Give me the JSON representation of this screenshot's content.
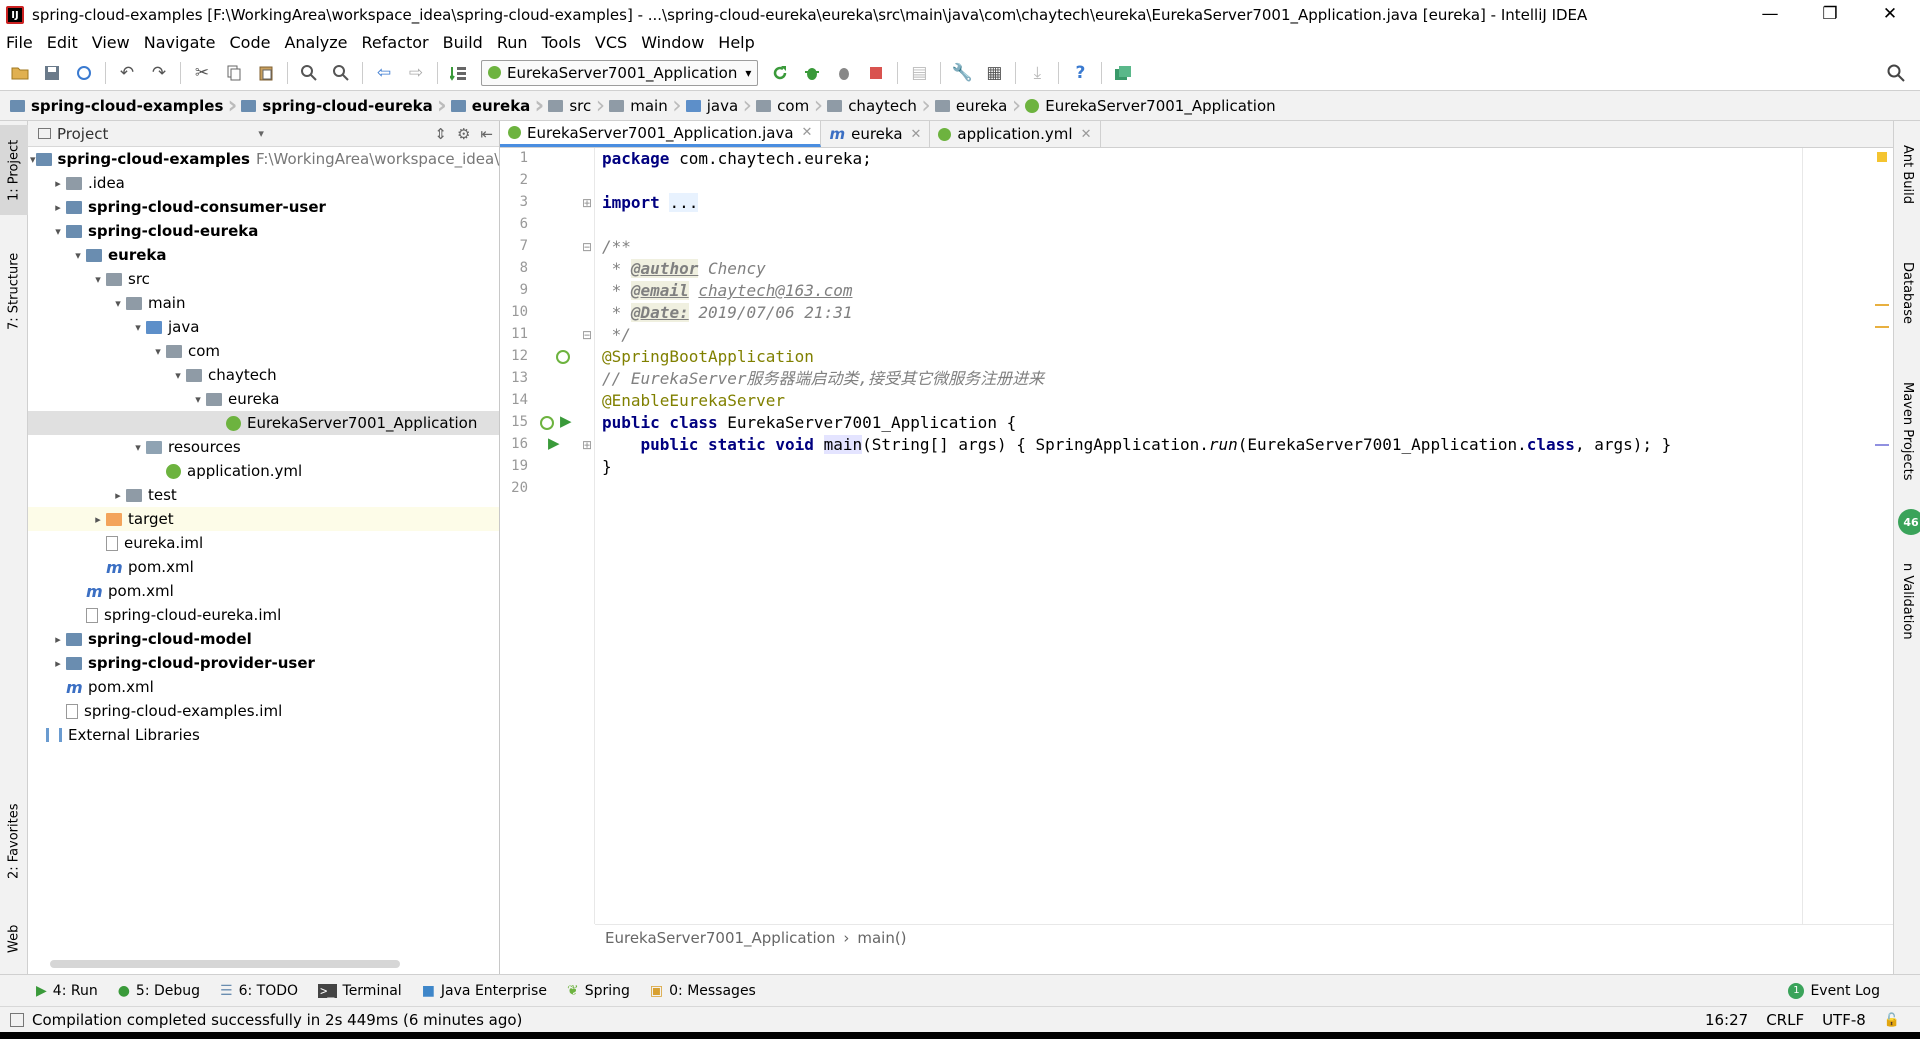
{
  "window": {
    "title": "spring-cloud-examples [F:\\WorkingArea\\workspace_idea\\spring-cloud-examples] - ...\\spring-cloud-eureka\\eureka\\src\\main\\java\\com\\chaytech\\eureka\\EurekaServer7001_Application.java [eureka] - IntelliJ IDEA",
    "minimize": "—",
    "restore": "❐",
    "close": "✕"
  },
  "menu": [
    "File",
    "Edit",
    "View",
    "Navigate",
    "Code",
    "Analyze",
    "Refactor",
    "Build",
    "Run",
    "Tools",
    "VCS",
    "Window",
    "Help"
  ],
  "toolbar": {
    "run_config": "EurekaServer7001_Application",
    "run_config_caret": "▾"
  },
  "breadcrumb": [
    "spring-cloud-examples",
    "spring-cloud-eureka",
    "eureka",
    "src",
    "main",
    "java",
    "com",
    "chaytech",
    "eureka",
    "EurekaServer7001_Application"
  ],
  "left_tools": {
    "project": "1: Project",
    "structure": "7: Structure",
    "favorites": "2: Favorites",
    "web": "Web"
  },
  "right_tools": {
    "ant": "Ant Build",
    "database": "Database",
    "maven": "Maven Projects",
    "validation": "n Validation",
    "validation_badge": "46"
  },
  "project_panel": {
    "header": "Project",
    "tree": [
      {
        "label": "spring-cloud-examples",
        "path": "F:\\WorkingArea\\workspace_idea\\spri",
        "level": 0,
        "arrow": "▾",
        "icon": "foldmod",
        "bold": true
      },
      {
        "label": ".idea",
        "level": 1,
        "arrow": "▸",
        "icon": "fold"
      },
      {
        "label": "spring-cloud-consumer-user",
        "level": 1,
        "arrow": "▸",
        "icon": "foldmod",
        "bold": true
      },
      {
        "label": "spring-cloud-eureka",
        "level": 1,
        "arrow": "▾",
        "icon": "foldmod",
        "bold": true
      },
      {
        "label": "eureka",
        "level": 2,
        "arrow": "▾",
        "icon": "foldmod",
        "bold": true
      },
      {
        "label": "src",
        "level": 3,
        "arrow": "▾",
        "icon": "fold"
      },
      {
        "label": "main",
        "level": 4,
        "arrow": "▾",
        "icon": "fold"
      },
      {
        "label": "java",
        "level": 5,
        "arrow": "▾",
        "icon": "foldsrc"
      },
      {
        "label": "com",
        "level": 6,
        "arrow": "▾",
        "icon": "fold"
      },
      {
        "label": "chaytech",
        "level": 7,
        "arrow": "▾",
        "icon": "fold"
      },
      {
        "label": "eureka",
        "level": 8,
        "arrow": "▾",
        "icon": "fold"
      },
      {
        "label": "EurekaServer7001_Application",
        "level": 9,
        "arrow": "",
        "icon": "spring",
        "selected": true
      },
      {
        "label": "resources",
        "level": 5,
        "arrow": "▾",
        "icon": "foldres"
      },
      {
        "label": "application.yml",
        "level": 6,
        "arrow": "",
        "icon": "spring"
      },
      {
        "label": "test",
        "level": 4,
        "arrow": "▸",
        "icon": "fold"
      },
      {
        "label": "target",
        "level": 3,
        "arrow": "▸",
        "icon": "foldtarget",
        "highlight": true
      },
      {
        "label": "eureka.iml",
        "level": 3,
        "arrow": "",
        "icon": "file"
      },
      {
        "label": "pom.xml",
        "level": 3,
        "arrow": "",
        "icon": "mvn"
      },
      {
        "label": "pom.xml",
        "level": 2,
        "arrow": "",
        "icon": "mvn"
      },
      {
        "label": "spring-cloud-eureka.iml",
        "level": 2,
        "arrow": "",
        "icon": "file"
      },
      {
        "label": "spring-cloud-model",
        "level": 1,
        "arrow": "▸",
        "icon": "foldmod",
        "bold": true
      },
      {
        "label": "spring-cloud-provider-user",
        "level": 1,
        "arrow": "▸",
        "icon": "foldmod",
        "bold": true
      },
      {
        "label": "pom.xml",
        "level": 1,
        "arrow": "",
        "icon": "mvn"
      },
      {
        "label": "spring-cloud-examples.iml",
        "level": 1,
        "arrow": "",
        "icon": "file"
      },
      {
        "label": "External Libraries",
        "level": 0,
        "arrow": "",
        "icon": "libs"
      }
    ]
  },
  "editor": {
    "tabs": [
      {
        "label": "EurekaServer7001_Application.java",
        "active": true,
        "color": "#6db33f"
      },
      {
        "label": "eureka",
        "active": false,
        "color": "mvn"
      },
      {
        "label": "application.yml",
        "active": false,
        "color": "#6db33f"
      }
    ],
    "line_numbers": [
      "1",
      "2",
      "3",
      "6",
      "7",
      "8",
      "9",
      "10",
      "11",
      "12",
      "13",
      "14",
      "15",
      "16",
      "19",
      "20"
    ],
    "code": {
      "l1_kw": "package",
      "l1_rest": " com.chaytech.eureka;",
      "l3_kw": "import",
      "l3_dots": "...",
      "l7": "/**",
      "l8_pre": " * ",
      "l8_tag": "@author",
      "l8_val": " Chency",
      "l9_pre": " * ",
      "l9_tag": "@email",
      "l9_val": "chaytech@163.com",
      "l10_pre": " * ",
      "l10_tag": "@Date:",
      "l10_val": " 2019/07/06 21:31",
      "l11": " */",
      "l12": "@SpringBootApplication",
      "l13": "// EurekaServer服务器端启动类,接受其它微服务注册进来",
      "l14": "@EnableEurekaServer",
      "l15_kw": "public class",
      "l15_rest": " EurekaServer7001_Application {",
      "l16_kw": "public static void",
      "l16_main": "main",
      "l16_a": "(String[] args) { SpringApplication.",
      "l16_run": "run",
      "l16_b": "(EurekaServer7001_Application.",
      "l16_class": "class",
      "l16_c": ", args); }",
      "l19": "}"
    },
    "footer_class": "EurekaServer7001_Application",
    "footer_sep": "›",
    "footer_method": "main()"
  },
  "bottom_tools": [
    {
      "label": "4: Run",
      "color": "#3a9a3a"
    },
    {
      "label": "5: Debug",
      "color": "#3a9a3a"
    },
    {
      "label": "6: TODO",
      "color": "#6a8db0"
    },
    {
      "label": "Terminal",
      "color": "#444"
    },
    {
      "label": "Java Enterprise",
      "color": "#3e86c9"
    },
    {
      "label": "Spring",
      "color": "#6db33f"
    },
    {
      "label": "0: Messages",
      "color": "#d8a030"
    }
  ],
  "event_log": "Event Log",
  "event_log_badge": "1",
  "status": {
    "message": "Compilation completed successfully in 2s 449ms (6 minutes ago)",
    "position": "16:27",
    "line_sep": "CRLF",
    "encoding": "UTF-8"
  },
  "colors": {
    "accent": "#4a8ee0",
    "keyword": "#000080",
    "annotation": "#808000",
    "comment": "#808080"
  }
}
